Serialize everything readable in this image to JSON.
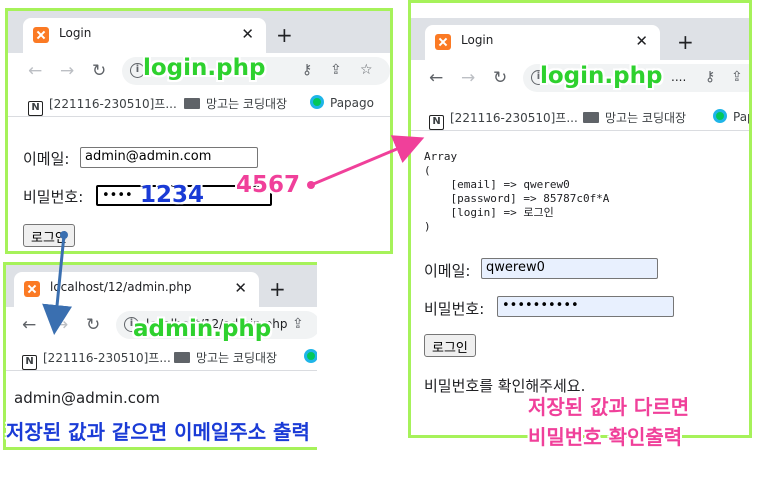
{
  "left_window": {
    "tab_title": "Login",
    "url": "lo...",
    "bookmarks": [
      "[221116-230510]프...",
      "망고는 코딩대장",
      "Papago"
    ],
    "email_label": "이메일:",
    "email_value": "admin@admin.com",
    "password_label": "비밀번호:",
    "password_value": "••••",
    "login_button": "로그인"
  },
  "right_window": {
    "tab_title": "Login",
    "url": "....",
    "bookmarks": [
      "[221116-230510]프...",
      "망고는 코딩대장",
      "Papa"
    ],
    "debug_output": "Array\n(\n    [email] => qwerew0\n    [password] => 85787c0f*A\n    [login] => 로그인\n)",
    "email_label": "이메일:",
    "email_value": "qwerew0",
    "password_label": "비밀번호:",
    "password_value": "••••••••••",
    "login_button": "로그인",
    "message": "비밀번호를 확인해주세요."
  },
  "bottom_window": {
    "tab_title": "localhost/12/admin.php",
    "url": "localhost/12/admin.php",
    "bookmarks": [
      "[221116-230510]프...",
      "망고는 코딩대장"
    ],
    "output": "admin@admin.com"
  },
  "annotations": {
    "login_php_left": "login.php",
    "login_php_right": "login.php",
    "admin_php": "admin.php",
    "pw_1234": "1234",
    "pw_4567": "4567",
    "same_caption": "저장된 값과 같으면 이메일주소 출력",
    "diff_line1": "저장된 값과 다르면",
    "diff_line2": "비밀번호 확인출력"
  },
  "colors": {
    "frame_border": "#a6f25a",
    "annotation_green": "#2ed12e",
    "annotation_blue": "#1a3bd6",
    "annotation_pink": "#f0409a",
    "arrow_blue": "#3a6fb0"
  }
}
